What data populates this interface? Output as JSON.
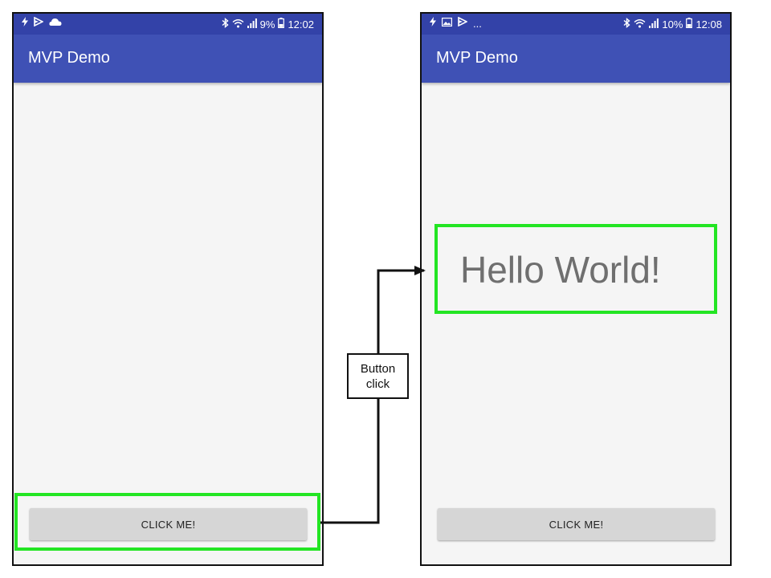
{
  "colors": {
    "status_bar": "#3342a8",
    "app_bar": "#3f51b5",
    "highlight": "#23e523",
    "screen_background": "#f5f5f5",
    "button": "#d6d6d6",
    "hello_text": "#6f6f6f"
  },
  "left_screen": {
    "status_bar": {
      "icons_left": [
        "flash-icon",
        "play-icon",
        "cloud-icon"
      ],
      "icons_right": [
        "bluetooth-icon",
        "wifi-icon",
        "signal-icon",
        "battery-icon"
      ],
      "battery": "9%",
      "time": "12:02"
    },
    "app_title": "MVP Demo",
    "button_label": "CLICK ME!"
  },
  "right_screen": {
    "status_bar": {
      "icons_left": [
        "flash-icon",
        "image-icon",
        "play-icon"
      ],
      "overflow": "...",
      "icons_right": [
        "bluetooth-icon",
        "wifi-icon",
        "signal-icon",
        "battery-icon"
      ],
      "battery": "10%",
      "time": "12:08"
    },
    "app_title": "MVP Demo",
    "result_text": "Hello World!",
    "button_label": "CLICK ME!"
  },
  "annotation": {
    "line1": "Button",
    "line2": "click"
  }
}
